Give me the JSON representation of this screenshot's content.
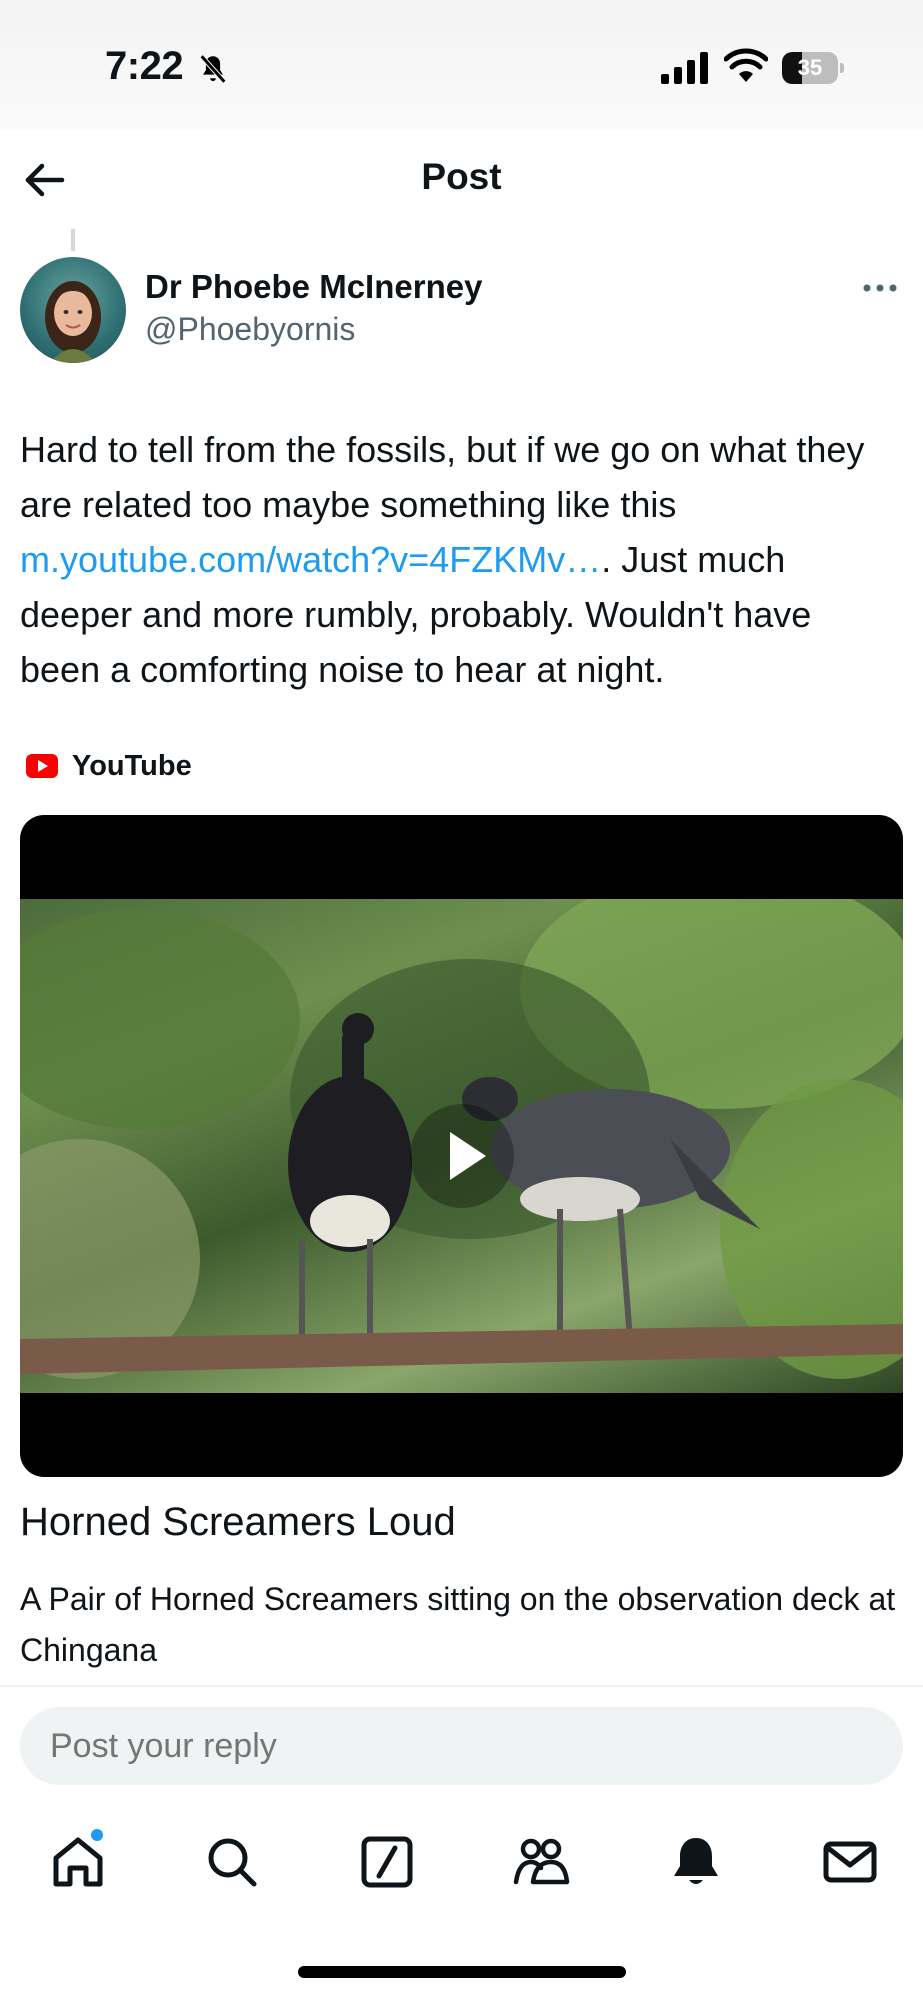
{
  "status_bar": {
    "time": "7:22",
    "battery_level": "35",
    "battery_percent": 35
  },
  "header": {
    "title": "Post"
  },
  "post": {
    "author_name": "Dr Phoebe McInerney",
    "author_handle": "@Phoebyornis",
    "text_before_link": "Hard to tell from the fossils, but if we go on what they are related too maybe something like this ",
    "link_text": "m.youtube.com/watch?v=4FZKMv…",
    "text_after_link": ". Just much deeper and more rumbly, probably. Wouldn't have been a comforting noise to hear at night."
  },
  "card": {
    "source": "YouTube",
    "title": "Horned Screamers Loud",
    "description": "A Pair of Horned Screamers sitting on the observation deck at Chingana"
  },
  "reply": {
    "placeholder": "Post your reply"
  },
  "tabs": [
    {
      "icon": "home-icon",
      "active": true,
      "has_dot": true
    },
    {
      "icon": "search-icon"
    },
    {
      "icon": "grok-icon"
    },
    {
      "icon": "communities-icon"
    },
    {
      "icon": "notifications-icon"
    },
    {
      "icon": "messages-icon"
    }
  ],
  "colors": {
    "accent": "#1d9bf0",
    "text": "#0f1419",
    "secondary": "#536471",
    "youtube_red": "#ff0000"
  }
}
